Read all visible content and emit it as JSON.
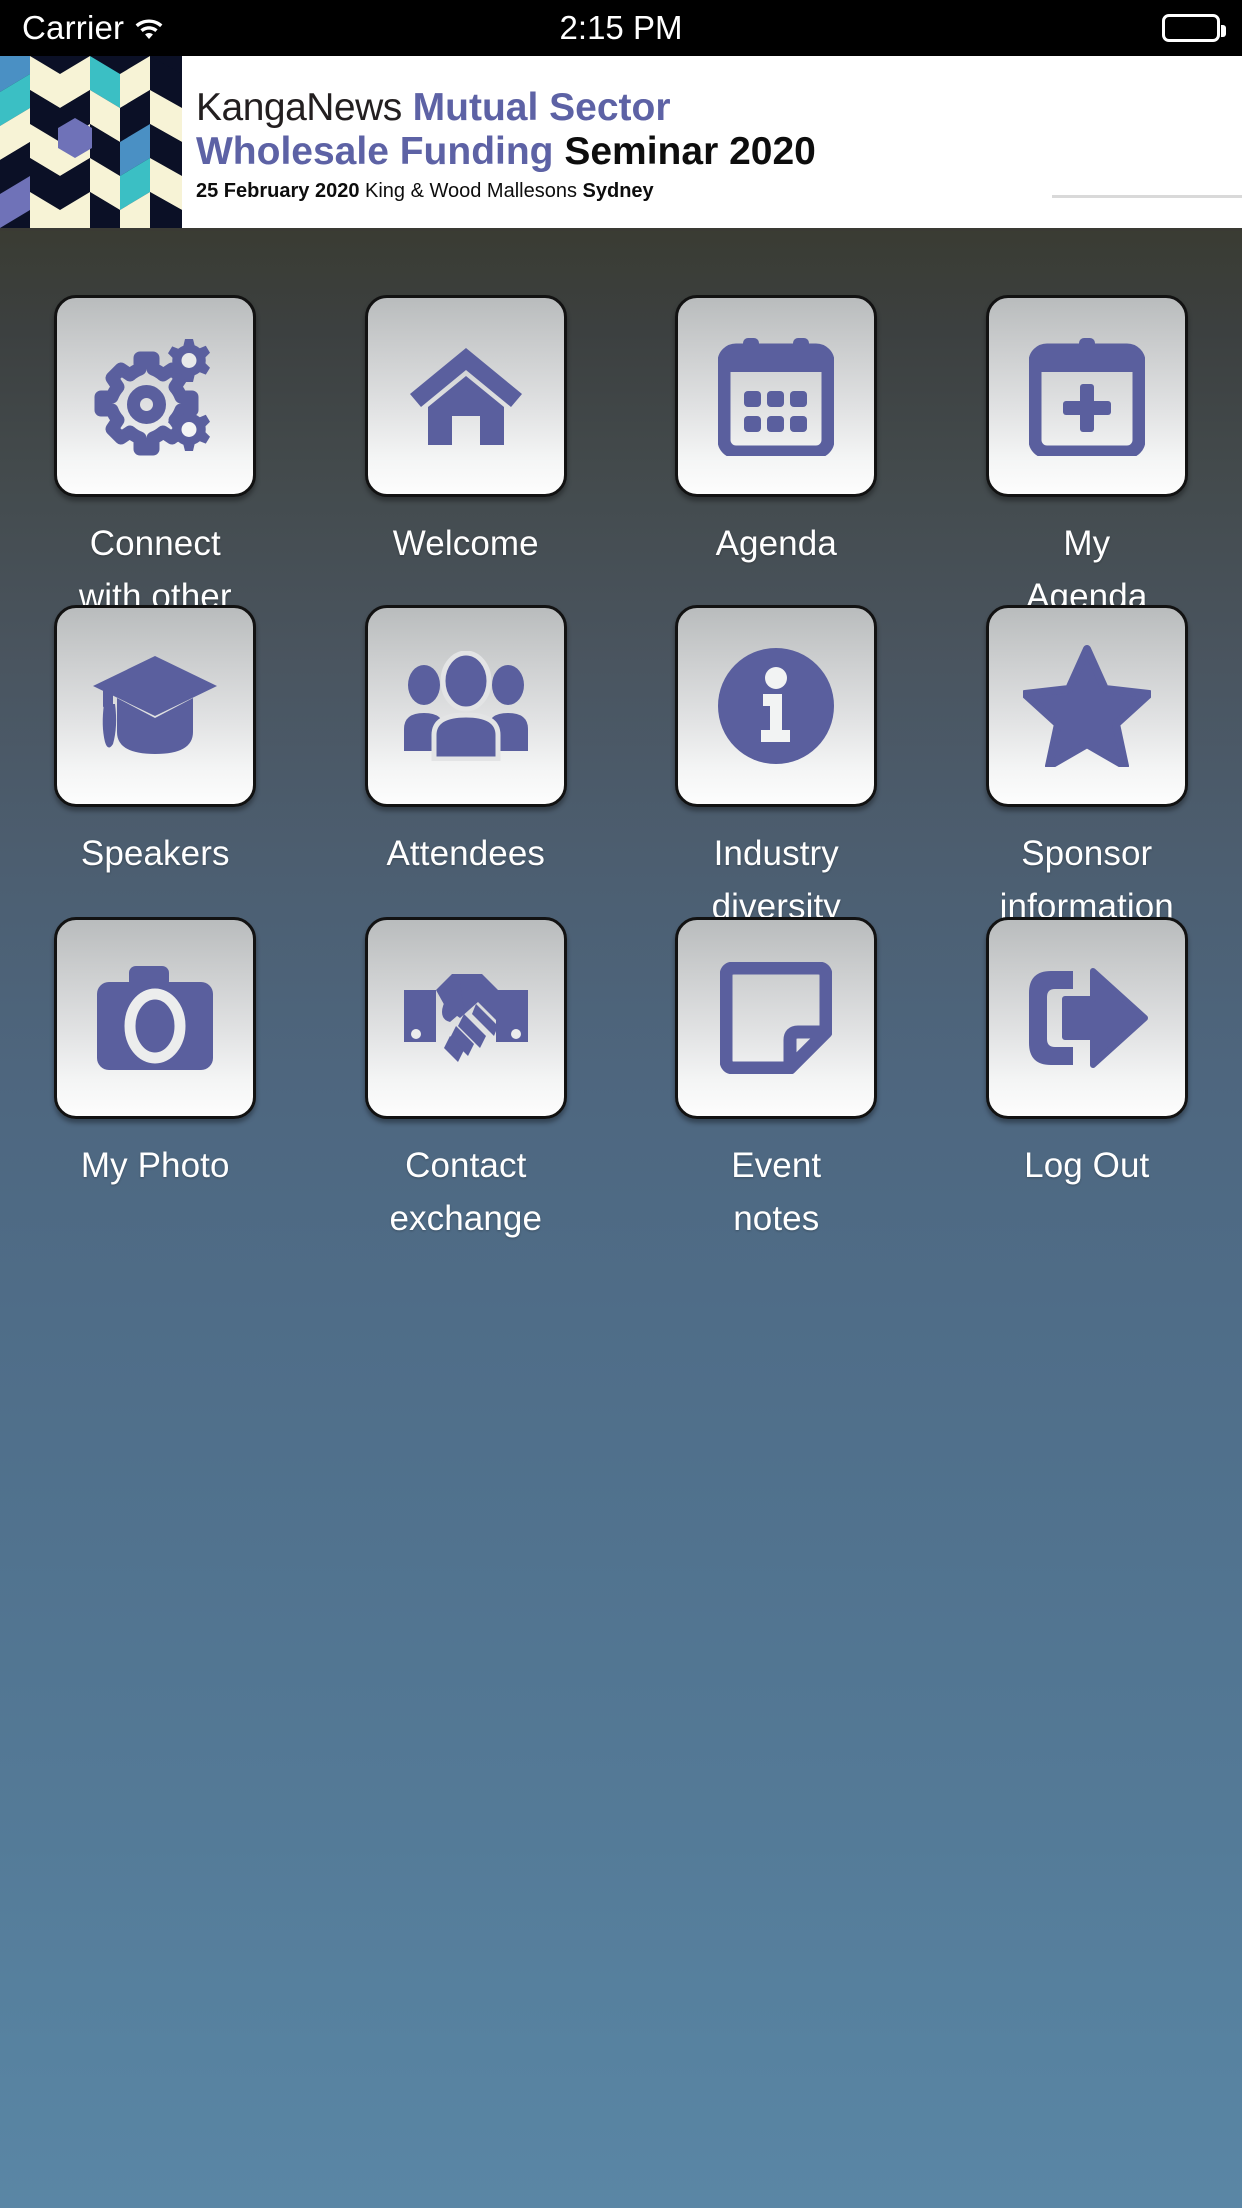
{
  "status_bar": {
    "carrier": "Carrier",
    "wifi_icon": "wifi-icon",
    "time": "2:15 PM",
    "battery_icon": "battery-icon"
  },
  "banner": {
    "pattern_icon": "geometric-hexagon-pattern",
    "title_part1": "KangaNews",
    "title_part2": "Mutual Sector",
    "title_part3": "Wholesale Funding",
    "title_part4": "Seminar 2020",
    "date": "25 February 2020",
    "venue": "King & Wood Mallesons",
    "city": "Sydney"
  },
  "colors": {
    "icon_blue": "#5a5f9e",
    "banner_accent": "#5d62a5",
    "label_text": "#ffffff",
    "background_top": "#3a3c33",
    "background_bottom": "#5a86a5"
  },
  "grid": {
    "rows": [
      [
        {
          "label": "Connect\nwith other\ndelegates",
          "icon": "gears-icon",
          "name": "connect-with-other-delegates"
        },
        {
          "label": "Welcome",
          "icon": "home-icon",
          "name": "welcome"
        },
        {
          "label": "Agenda",
          "icon": "calendar-icon",
          "name": "agenda"
        },
        {
          "label": "My\nAgenda",
          "icon": "calendar-plus-icon",
          "name": "my-agenda"
        }
      ],
      [
        {
          "label": "Speakers",
          "icon": "graduation-cap-icon",
          "name": "speakers"
        },
        {
          "label": "Attendees",
          "icon": "people-group-icon",
          "name": "attendees"
        },
        {
          "label": "Industry\ndiversity",
          "icon": "info-circle-icon",
          "name": "industry-diversity"
        },
        {
          "label": "Sponsor\ninformation",
          "icon": "star-icon",
          "name": "sponsor-information"
        }
      ],
      [
        {
          "label": "My Photo",
          "icon": "camera-icon",
          "name": "my-photo"
        },
        {
          "label": "Contact\nexchange",
          "icon": "handshake-icon",
          "name": "contact-exchange"
        },
        {
          "label": "Event\nnotes",
          "icon": "note-page-icon",
          "name": "event-notes"
        },
        {
          "label": "Log Out",
          "icon": "logout-arrow-icon",
          "name": "log-out"
        }
      ]
    ]
  }
}
